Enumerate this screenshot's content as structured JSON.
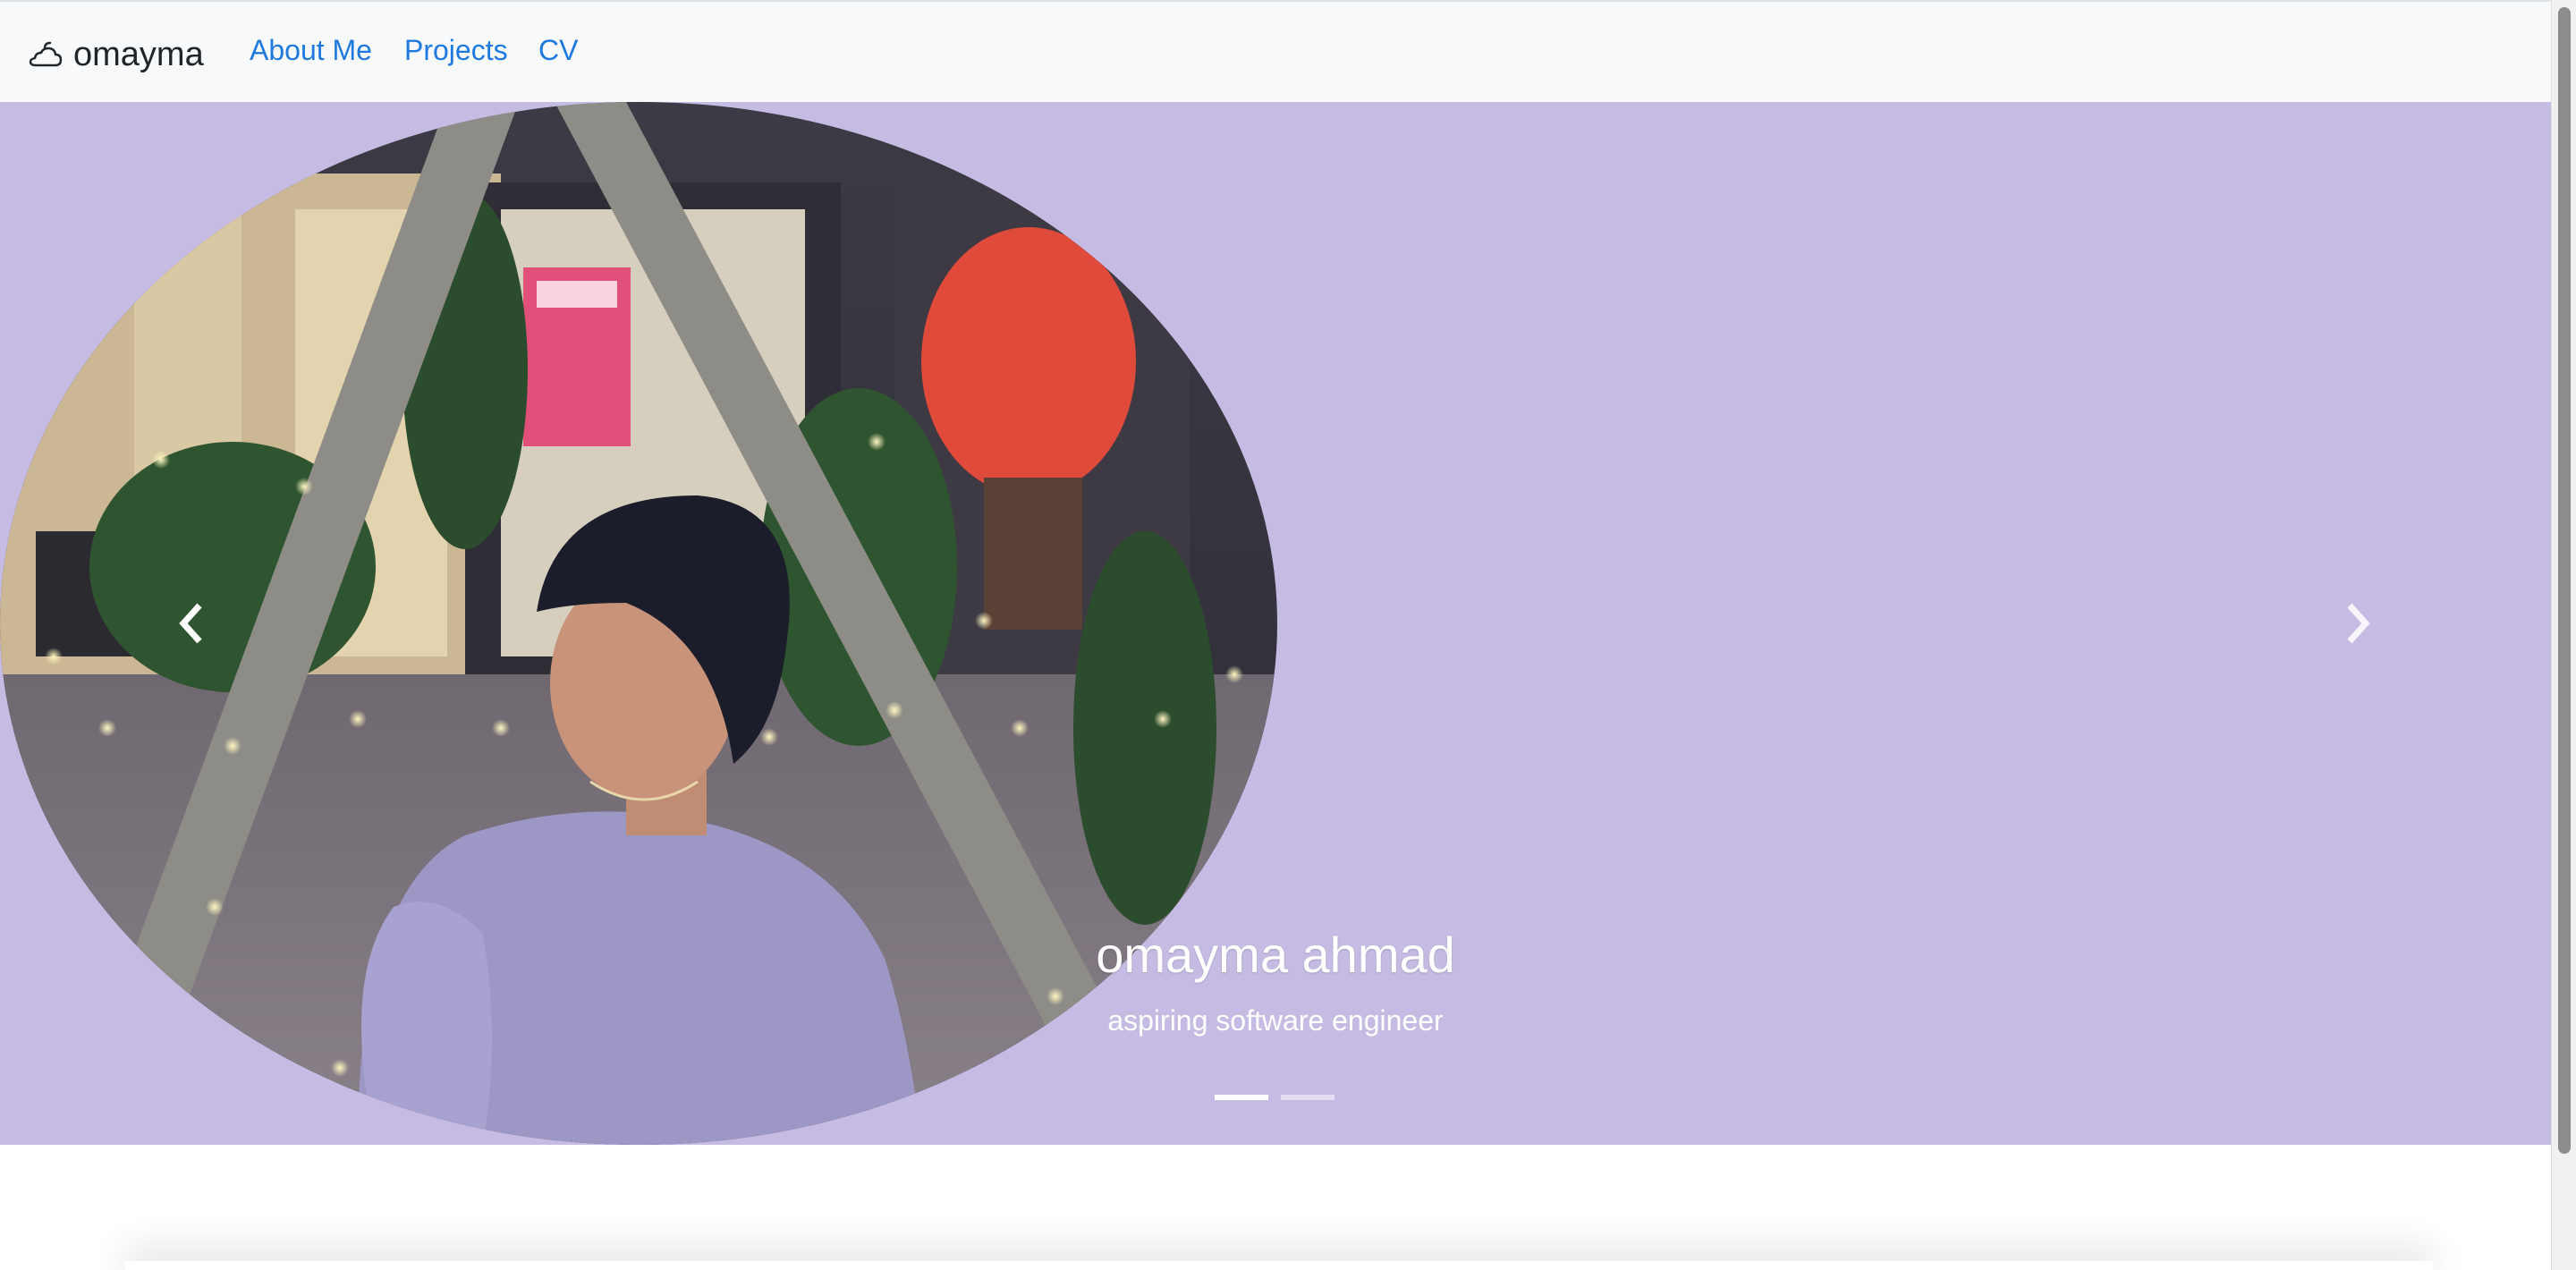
{
  "navbar": {
    "brand_icon": "cloud-sun-icon",
    "brand": "omayma",
    "links": [
      {
        "label": "About Me"
      },
      {
        "label": "Projects"
      },
      {
        "label": "CV"
      }
    ]
  },
  "carousel": {
    "background": "#c5bbe3",
    "slide_image": "portrait-photo",
    "caption": {
      "title": "omayma ahmad",
      "subtitle": "aspiring software engineer"
    },
    "prev_icon": "chevron-left-icon",
    "next_icon": "chevron-right-icon",
    "indicators": [
      {
        "active": true
      },
      {
        "active": false
      }
    ]
  },
  "colors": {
    "accent": "#1f7ae0",
    "navbar_bg": "#f8f9fa"
  }
}
